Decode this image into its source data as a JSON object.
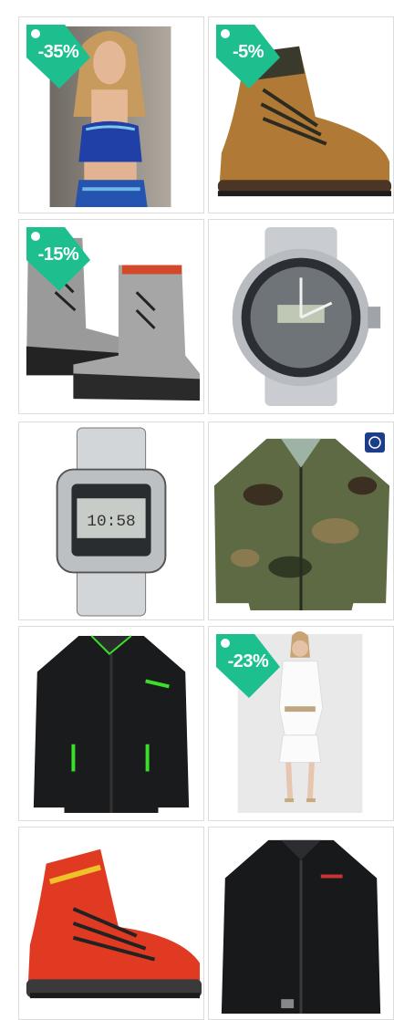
{
  "ad_controls": {
    "adchoices_icon": "adchoices-triangle-icon",
    "close_icon": "close-x-icon",
    "accent": "#29a9d8"
  },
  "discount_color": "#1ebf8e",
  "products": [
    {
      "id": "sports-bra",
      "discount": "-35%"
    },
    {
      "id": "hiking-boot-brown",
      "discount": "-5%"
    },
    {
      "id": "snow-boots-grey",
      "discount": "-15%"
    },
    {
      "id": "steel-sport-watch",
      "discount": ""
    },
    {
      "id": "digital-steel-watch",
      "discount": ""
    },
    {
      "id": "camo-field-jacket",
      "discount": "",
      "badge_icon": "brand-badge-icon"
    },
    {
      "id": "black-green-softshell-jacket",
      "discount": ""
    },
    {
      "id": "white-dress",
      "discount": "-23%"
    },
    {
      "id": "red-trekking-boot",
      "discount": ""
    },
    {
      "id": "black-fleece-jacket",
      "discount": ""
    }
  ]
}
